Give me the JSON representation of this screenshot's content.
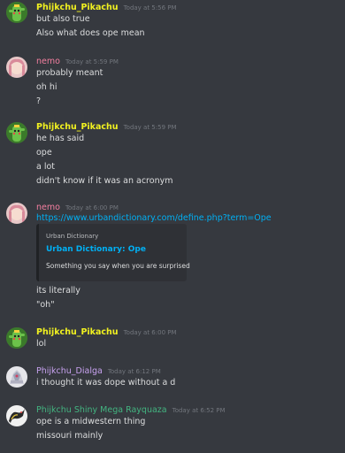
{
  "colors": {
    "background": "#36393f",
    "pikachu_name": "#f1f120",
    "nemo_name": "#f47fa0",
    "dialga_name": "#c8a2f0",
    "rayquaza_name": "#43b581",
    "link": "#00b0f4",
    "timestamp": "#72767d"
  },
  "messages": [
    {
      "author": "Phijkchu_Pikachu",
      "timestamp": "Today at 5:56 PM",
      "avatar_icon": "pikachu-cactus-icon",
      "lines": [
        "but also true",
        "Also what does ope mean"
      ]
    },
    {
      "author": "nemo",
      "timestamp": "Today at 5:59 PM",
      "avatar_icon": "pink-hair-avatar-icon",
      "lines": [
        "probably meant",
        "oh hi",
        "?"
      ]
    },
    {
      "author": "Phijkchu_Pikachu",
      "timestamp": "Today at 5:59 PM",
      "avatar_icon": "pikachu-cactus-icon",
      "lines": [
        "he has said",
        "ope",
        "a lot",
        "didn't know if it was an acronym"
      ]
    },
    {
      "author": "nemo",
      "timestamp": "Today at 6:00 PM",
      "avatar_icon": "pink-hair-avatar-icon",
      "link": "https://www.urbandictionary.com/define.php?term=Ope",
      "embed": {
        "provider": "Urban Dictionary",
        "title": "Urban Dictionary: Ope",
        "description": "Something you say when you are surprised"
      },
      "lines": [
        "its literally",
        "\"oh\""
      ]
    },
    {
      "author": "Phijkchu_Pikachu",
      "timestamp": "Today at 6:00 PM",
      "avatar_icon": "pikachu-cactus-icon",
      "lines": [
        "lol"
      ]
    },
    {
      "author": "Phijkchu_Dialga",
      "timestamp": "Today at 6:12 PM",
      "avatar_icon": "dialga-avatar-icon",
      "lines": [
        "i thought it was dope without a d"
      ]
    },
    {
      "author": "Phijkchu Shiny Mega Rayquaza",
      "timestamp": "Today at 6:52 PM",
      "avatar_icon": "rayquaza-avatar-icon",
      "lines": [
        "ope is a midwestern thing",
        "missouri mainly"
      ]
    }
  ]
}
